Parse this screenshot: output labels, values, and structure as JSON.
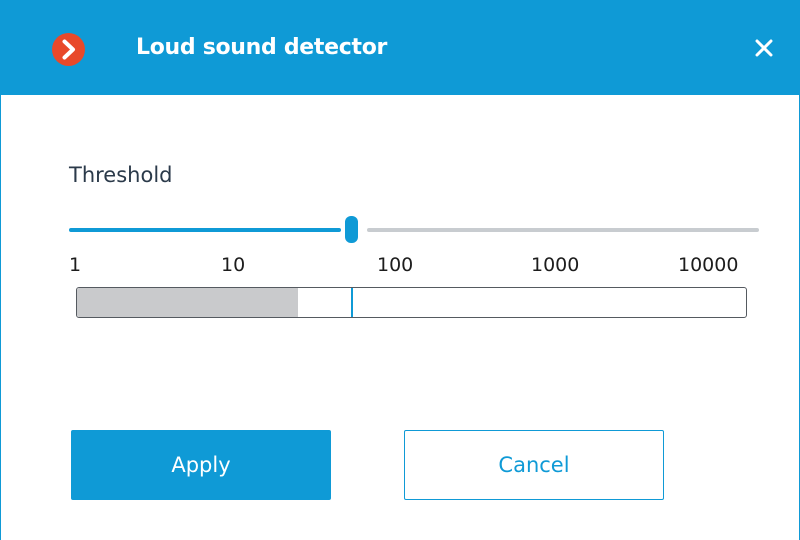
{
  "window": {
    "title": "Loud sound detector",
    "icon": "chevron-right-circle-icon",
    "close_icon": "close-icon"
  },
  "threshold": {
    "label": "Threshold",
    "scale": "log",
    "ticks": [
      "1",
      "10",
      "100",
      "1000",
      "10000"
    ],
    "slider_value_fraction": 0.41,
    "meter_level_fraction": 0.33,
    "meter_marker_fraction": 0.41
  },
  "buttons": {
    "apply_label": "Apply",
    "cancel_label": "Cancel"
  },
  "colors": {
    "accent": "#0f9ad6",
    "app_icon": "#e8492a",
    "meter_fill": "#c9cacc",
    "track_inactive": "#c8ccd0"
  }
}
